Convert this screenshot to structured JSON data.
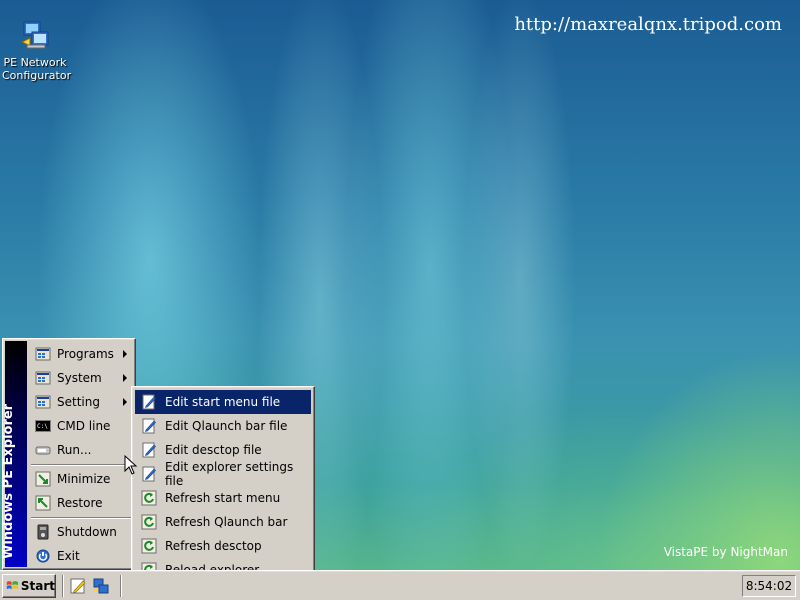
{
  "desktop": {
    "url_text": "http://maxrealqnx.tripod.com",
    "brand_text": "VistaPE by NightMan",
    "icons": [
      {
        "label_line1": "PE Network",
        "label_line2": "Configurator",
        "icon": "network-configurator-icon"
      }
    ]
  },
  "start_menu": {
    "banner": "Windows PE Explorer",
    "items": [
      {
        "label": "Programs",
        "icon": "programs-folder-icon",
        "submenu": true
      },
      {
        "label": "System",
        "icon": "system-folder-icon",
        "submenu": true
      },
      {
        "label": "Setting",
        "icon": "setting-folder-icon",
        "submenu": true
      },
      {
        "label": "CMD line",
        "icon": "cmd-icon",
        "submenu": false
      },
      {
        "label": "Run...",
        "icon": "run-icon",
        "submenu": false
      },
      {
        "label": "Minimize",
        "icon": "minimize-icon",
        "submenu": false
      },
      {
        "label": "Restore",
        "icon": "restore-icon",
        "submenu": false
      },
      {
        "label": "Shutdown",
        "icon": "shutdown-icon",
        "submenu": false
      },
      {
        "label": "Exit",
        "icon": "exit-icon",
        "submenu": false
      }
    ]
  },
  "setting_submenu": {
    "items": [
      {
        "label": "Edit start menu file",
        "icon": "edit-file-icon"
      },
      {
        "label": "Edit Qlaunch bar file",
        "icon": "edit-file-icon"
      },
      {
        "label": "Edit desctop file",
        "icon": "edit-file-icon"
      },
      {
        "label": "Edit explorer settings file",
        "icon": "edit-file-icon"
      },
      {
        "label": "Refresh start menu",
        "icon": "refresh-icon"
      },
      {
        "label": "Refresh Qlaunch bar",
        "icon": "refresh-icon"
      },
      {
        "label": "Refresh desctop",
        "icon": "refresh-icon"
      },
      {
        "label": "Reload explorer",
        "icon": "refresh-icon"
      }
    ],
    "highlighted_index": 0
  },
  "taskbar": {
    "start_label": "Start",
    "clock": "8:54:02"
  },
  "colors": {
    "menu_bg": "#d4d0c8",
    "highlight": "#0a246a",
    "banner_blue": "#0000c8"
  }
}
